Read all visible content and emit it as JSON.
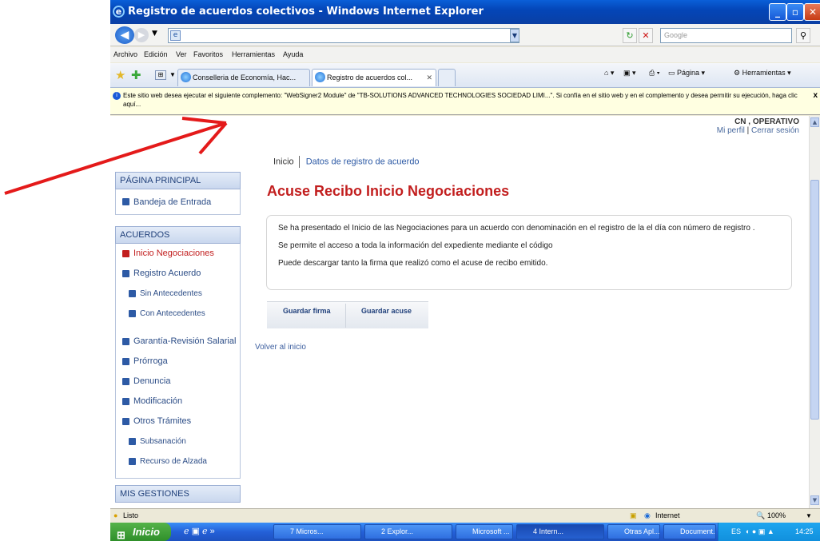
{
  "window": {
    "title": "Registro de acuerdos colectivos - Windows Internet Explorer",
    "controls": [
      "_",
      "▫",
      "✕"
    ]
  },
  "search": {
    "placeholder": "Google"
  },
  "menu": [
    "Archivo",
    "Edición",
    "Ver",
    "Favoritos",
    "Herramientas",
    "Ayuda"
  ],
  "tabs": [
    {
      "label": "Conselleria de Economía, Hac..."
    },
    {
      "label": "Registro de acuerdos col..."
    }
  ],
  "commandbar": {
    "page": "Página",
    "tools": "Herramientas"
  },
  "infobar": {
    "text": "Este sitio web desea ejecutar el siguiente complemento: \"WebSigner2 Module\" de \"TB-SOLUTIONS ADVANCED TECHNOLOGIES SOCIEDAD LIMI...\". Si confía en el sitio web y en el complemento y desea permitir su ejecución, haga clic aquí...",
    "close": "x"
  },
  "user": {
    "name": "CN , OPERATIVO",
    "profile": "Mi perfil",
    "logout": "Cerrar sesión",
    "sep": "|"
  },
  "breadcrumb": {
    "home": "Inicio",
    "current": "Datos de registro de acuerdo"
  },
  "page": {
    "title": "Acuse Recibo Inicio Negociaciones",
    "back": "Volver al inicio"
  },
  "message": {
    "p1": "Se ha presentado el Inicio de las Negociaciones para un acuerdo con denominación en el registro de la el día con número de registro .",
    "p2": "Se permite el acceso a toda la información del expediente mediante el código",
    "p3": "Puede descargar tanto la firma que realizó como el acuse de recibo emitido."
  },
  "buttons": {
    "save_signature": "Guardar firma",
    "save_receipt": "Guardar acuse"
  },
  "sidebar": {
    "main_header": "PÁGINA PRINCIPAL",
    "inbox": "Bandeja de Entrada",
    "agreements_header": "ACUERDOS",
    "items": [
      "Inicio Negociaciones",
      "Registro Acuerdo",
      "Sin Antecedentes",
      "Con Antecedentes",
      "Garantía-Revisión Salarial",
      "Prórroga",
      "Denuncia",
      "Modificación",
      "Otros Trámites",
      "Subsanación",
      "Recurso de Alzada"
    ],
    "mis_header": "MIS GESTIONES"
  },
  "status": {
    "text": "Listo",
    "zone": "Internet",
    "zoom": "100%"
  },
  "taskbar": {
    "start": "Inicio",
    "items": [
      "7 Micros...",
      "2 Explor...",
      "Microsoft ...",
      "4 Intern...",
      "Otras Apl...",
      "Document..."
    ],
    "lang": "ES",
    "clock": "14:25"
  }
}
